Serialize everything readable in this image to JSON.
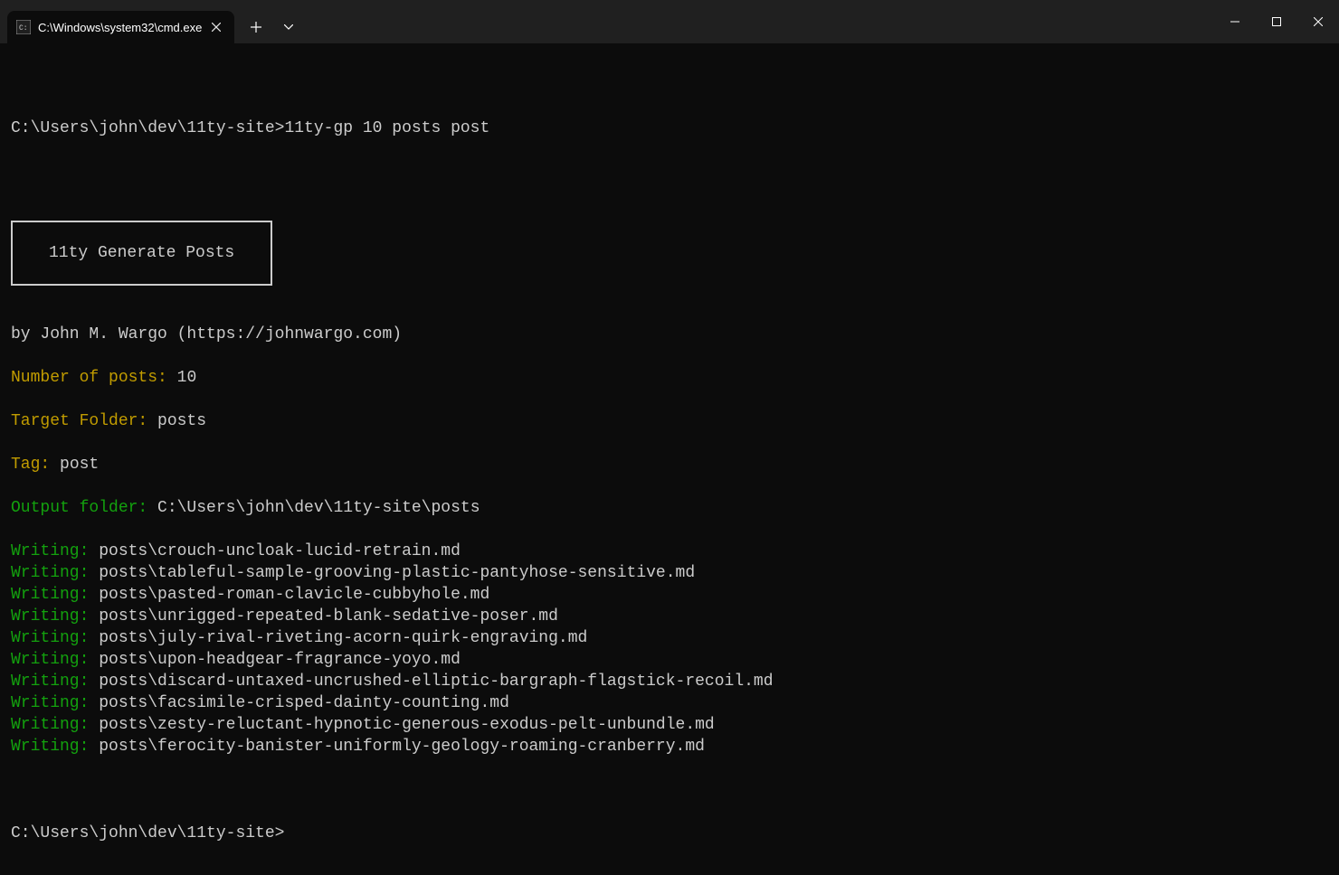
{
  "window": {
    "tab_title": "C:\\Windows\\system32\\cmd.exe"
  },
  "terminal": {
    "prompt_path": "C:\\Users\\john\\dev\\11ty-site>",
    "command": "11ty-gp 10 posts post",
    "box_title": "11ty Generate Posts",
    "author_line": "by John M. Wargo (https://johnwargo.com)",
    "info": {
      "num_posts_label": "Number of posts: ",
      "num_posts_value": "10",
      "target_folder_label": "Target Folder: ",
      "target_folder_value": "posts",
      "tag_label": "Tag: ",
      "tag_value": "post",
      "output_folder_label": "Output folder: ",
      "output_folder_value": "C:\\Users\\john\\dev\\11ty-site\\posts"
    },
    "writing_label": "Writing: ",
    "files": [
      "posts\\crouch-uncloak-lucid-retrain.md",
      "posts\\tableful-sample-grooving-plastic-pantyhose-sensitive.md",
      "posts\\pasted-roman-clavicle-cubbyhole.md",
      "posts\\unrigged-repeated-blank-sedative-poser.md",
      "posts\\july-rival-riveting-acorn-quirk-engraving.md",
      "posts\\upon-headgear-fragrance-yoyo.md",
      "posts\\discard-untaxed-uncrushed-elliptic-bargraph-flagstick-recoil.md",
      "posts\\facsimile-crisped-dainty-counting.md",
      "posts\\zesty-reluctant-hypnotic-generous-exodus-pelt-unbundle.md",
      "posts\\ferocity-banister-uniformly-geology-roaming-cranberry.md"
    ],
    "prompt2": "C:\\Users\\john\\dev\\11ty-site>"
  }
}
